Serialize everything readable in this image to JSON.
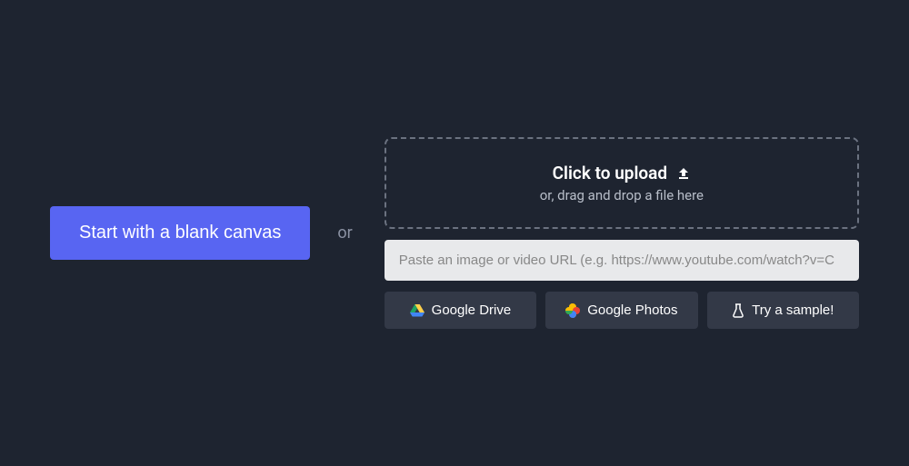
{
  "blank_canvas_button": "Start with a blank canvas",
  "separator": "or",
  "dropzone": {
    "title": "Click to upload",
    "subtitle": "or, drag and drop a file here"
  },
  "url_input": {
    "placeholder": "Paste an image or video URL (e.g. https://www.youtube.com/watch?v=C"
  },
  "buttons": {
    "google_drive": "Google Drive",
    "google_photos": "Google Photos",
    "try_sample": "Try a sample!"
  }
}
